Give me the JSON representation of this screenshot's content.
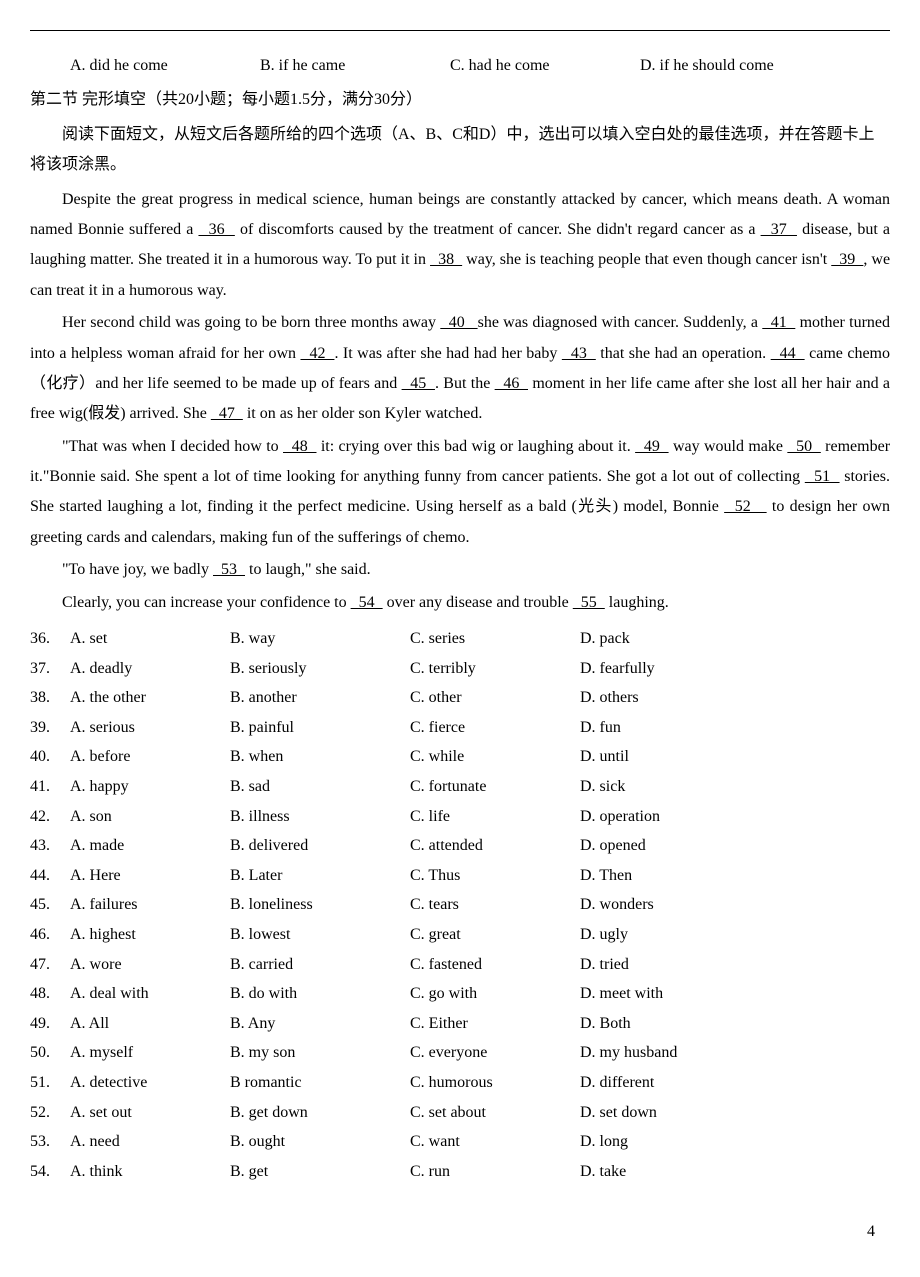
{
  "top_question": {
    "A": "A. did he come",
    "B": "B. if he came",
    "C": "C. had he come",
    "D": "D. if he should come"
  },
  "section_header": "第二节  完形填空（共20小题；每小题1.5分，满分30分）",
  "instruction": "阅读下面短文，从短文后各题所给的四个选项（A、B、C和D）中，选出可以填入空白处的最佳选项，并在答题卡上将该项涂黑。",
  "passage": {
    "p1a": "Despite the great progress in medical science, human beings are constantly attacked by cancer, which means death. A woman named Bonnie suffered a ",
    "b36": "  36  ",
    "p1b": " of discomforts caused by the treatment of cancer. She didn't regard cancer as a ",
    "b37": "  37  ",
    "p1c": " disease, but a laughing matter. She treated it in a humorous way. To put it in ",
    "b38": "  38  ",
    "p1d": " way, she is teaching people that even though cancer isn't ",
    "b39": "  39  ",
    "p1e": ", we can treat it in a humorous way.",
    "p2a": "Her second child was going to be born three months away ",
    "b40": "  40   ",
    "p2b": "she was diagnosed with cancer. Suddenly, a ",
    "b41": "  41  ",
    "p2c": " mother turned into a helpless woman afraid for her own ",
    "b42": "  42  ",
    "p2d": ". It was after she had had her baby ",
    "b43": "  43  ",
    "p2e": " that she had an operation. ",
    "b44": "  44  ",
    "p2f": " came chemo（化疗）and her life seemed to be made up of fears and ",
    "b45": "  45  ",
    "p2g": ". But the ",
    "b46": "  46  ",
    "p2h": " moment in her life came after she lost all her hair and a free wig(假发) arrived. She ",
    "b47": "  47  ",
    "p2i": " it on as her older son Kyler watched.",
    "p3a": "\"That was when I decided how to ",
    "b48": "  48  ",
    "p3b": " it: crying over this bad wig or laughing about it. ",
    "b49": "  49  ",
    "p3c": " way would make ",
    "b50": "  50  ",
    "p3d": " remember it.\"Bonnie said. She spent a lot of time looking for anything funny from cancer patients. She got a lot out of collecting ",
    "b51": "  51  ",
    "p3e": " stories. She started laughing a lot, finding it the perfect medicine. Using herself as a bald (光头) model, Bonnie ",
    "b52": "  52   ",
    "p3f": " to design her own greeting cards and calendars, making fun of the sufferings of chemo.",
    "p4a": "\"To have joy, we badly ",
    "b53": "  53  ",
    "p4b": " to laugh,\" she said.",
    "p5a": "Clearly, you can increase your confidence to ",
    "b54": "  54  ",
    "p5b": " over any disease and trouble ",
    "b55": "  55  ",
    "p5c": " laughing."
  },
  "questions": [
    {
      "n": "36.",
      "A": "A. set",
      "B": "B. way",
      "C": "C. series",
      "D": "D. pack"
    },
    {
      "n": "37.",
      "A": "A. deadly",
      "B": "B. seriously",
      "C": "C. terribly",
      "D": "D. fearfully"
    },
    {
      "n": "38.",
      "A": "A. the other",
      "B": "B. another",
      "C": "C. other",
      "D": "D. others"
    },
    {
      "n": "39.",
      "A": "A. serious",
      "B": "B. painful",
      "C": "C. fierce",
      "D": "D. fun"
    },
    {
      "n": "40.",
      "A": "A. before",
      "B": "   B. when",
      "C": "C. while",
      "D": "   D. until"
    },
    {
      "n": "41.",
      "A": "A. happy",
      "B": "B. sad",
      "C": "C. fortunate",
      "D": "D. sick"
    },
    {
      "n": "42.",
      "A": "A. son",
      "B": "B. illness",
      "C": "  C. life",
      "D": "     D. operation"
    },
    {
      "n": "43.",
      "A": "A. made",
      "B": "B. delivered",
      "C": "C. attended",
      "D": "D. opened"
    },
    {
      "n": "44.",
      "A": "A. Here",
      "B": "B. Later",
      "C": "C. Thus",
      "D": "D. Then"
    },
    {
      "n": "45.",
      "A": "A. failures",
      "B": "B. loneliness",
      "C": "C. tears",
      "D": "D. wonders"
    },
    {
      "n": "46.",
      "A": "A. highest",
      "B": "B. lowest",
      "C": "C. great",
      "D": "D. ugly"
    },
    {
      "n": "47.",
      "A": "A. wore",
      "B": "B. carried",
      "C": "C. fastened",
      "D": "D. tried"
    },
    {
      "n": "48.",
      "A": "A. deal with",
      "B": "B. do with",
      "C": "C. go with",
      "D": "D. meet with"
    },
    {
      "n": "49.",
      "A": "A. All",
      "B": "B. Any",
      "C": "C. Either",
      "D": "D. Both"
    },
    {
      "n": "50.",
      "A": "A. myself",
      "B": "B. my son",
      "C": "C. everyone",
      "D": "D. my husband"
    },
    {
      "n": "51.",
      "A": "A. detective",
      "B": "B romantic",
      "C": "C. humorous",
      "D": "D. different"
    },
    {
      "n": "52.",
      "A": "A. set out",
      "B": "B. get down",
      "C": "C. set about",
      "D": "D. set down"
    },
    {
      "n": "53.",
      "A": "A. need",
      "B": "B. ought",
      "C": "C. want",
      "D": "D. long"
    },
    {
      "n": "54.",
      "A": "A. think",
      "B": "B. get",
      "C": "C. run",
      "D": "D. take"
    }
  ],
  "page_number": "4"
}
